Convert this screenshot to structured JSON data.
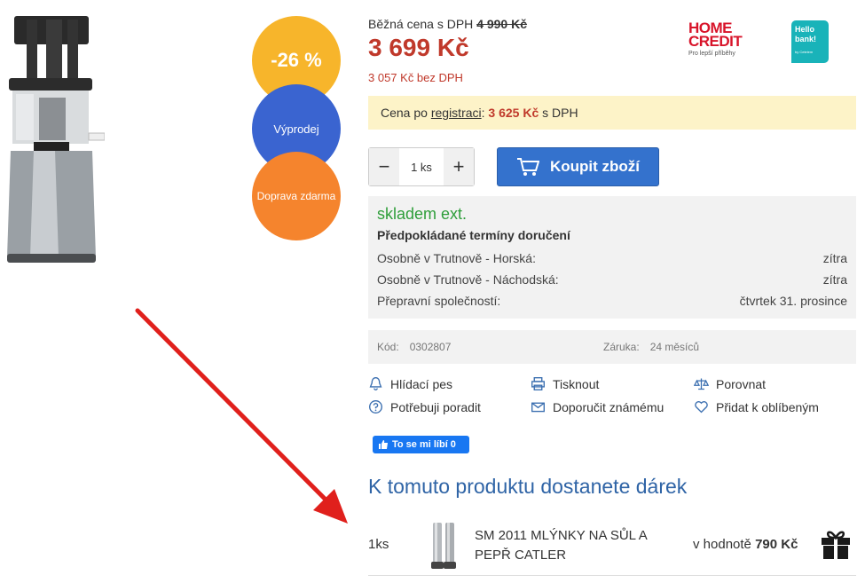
{
  "badges": {
    "discount": "-26 %",
    "sale": "Výprodej",
    "shipping": "Doprava zdarma"
  },
  "price": {
    "regular_label": "Běžná cena s DPH",
    "regular_value": "4 990 Kč",
    "current": "3 699 Kč",
    "without_vat": "3 057 Kč bez DPH"
  },
  "logos": {
    "home_credit_line1": "HOME",
    "home_credit_line2": "CREDIT",
    "home_credit_tagline": "Pro lepší příběhy",
    "hello_bank": "Hello bank!",
    "hello_bank_small": "by Cetelem"
  },
  "registration": {
    "prefix": "Cena po ",
    "link": "registraci",
    "sep": ": ",
    "price": "3 625 Kč",
    "suffix": " s DPH"
  },
  "cart": {
    "quantity": "1 ks",
    "minus": "−",
    "plus": "+",
    "buy_label": "Koupit zboží"
  },
  "stock": {
    "status": "skladem ext.",
    "heading": "Předpokládané termíny doručení",
    "rows": [
      {
        "label": "Osobně v Trutnově - Horská:",
        "value": "zítra"
      },
      {
        "label": "Osobně v Trutnově - Náchodská:",
        "value": "zítra"
      },
      {
        "label": "Přepravní společností:",
        "value": "čtvrtek 31. prosince"
      }
    ]
  },
  "product_info": {
    "code_label": "Kód:",
    "code_value": "0302807",
    "warranty_label": "Záruka:",
    "warranty_value": "24 měsíců"
  },
  "actions": {
    "watchdog": "Hlídací pes",
    "print": "Tisknout",
    "compare": "Porovnat",
    "advice": "Potřebuji poradit",
    "recommend": "Doporučit známému",
    "favorite": "Přidat k oblíbeným"
  },
  "facebook": {
    "like_label": "To se mi líbí 0"
  },
  "gift": {
    "title": "K tomuto produktu dostanete dárek",
    "qty": "1ks",
    "name": "SM 2011 MLÝNKY NA SŮL A PEPŘ CATLER",
    "value_label": "v hodnotě",
    "value": "790 Kč"
  },
  "colors": {
    "price_red": "#c0392b",
    "discount_badge": "#f7b52b",
    "sale_badge": "#3a64d0",
    "shipping_badge": "#f5842d",
    "buy_button": "#3472cd",
    "stock_green": "#2e9e3a",
    "gift_title_blue": "#2f64a6",
    "annotation_arrow": "#e0201c"
  }
}
